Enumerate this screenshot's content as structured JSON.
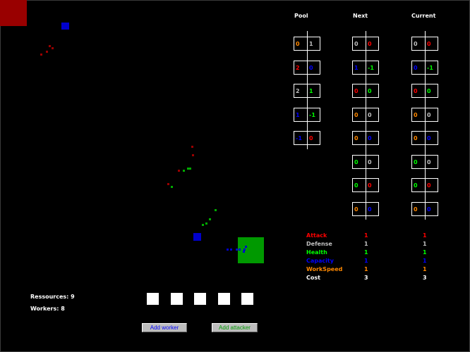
{
  "colors": {
    "background": "#000000",
    "red_base": "#990000",
    "red_unit": "#990000",
    "blue_base": "#0000cc",
    "blue_unit": "#0000cc",
    "green_base": "#009900",
    "green_unit": "#00aa00",
    "attack": "#ff0000",
    "defense": "#c0c0c0",
    "health": "#00ff00",
    "capacity": "#0000ff",
    "workspeed": "#ff8800",
    "cost": "#ffffff"
  },
  "columns": {
    "pool": "Pool",
    "next": "Next",
    "current": "Current"
  },
  "pool": [
    {
      "left": "0",
      "left_color": "workspeed",
      "right": "1",
      "right_color": "defense"
    },
    {
      "left": "2",
      "left_color": "attack",
      "right": "0",
      "right_color": "capacity"
    },
    {
      "left": "2",
      "left_color": "defense",
      "right": "1",
      "right_color": "health"
    },
    {
      "left": "1",
      "left_color": "capacity",
      "right": "-1",
      "right_color": "health"
    },
    {
      "left": "-1",
      "left_color": "capacity",
      "right": "0",
      "right_color": "attack"
    }
  ],
  "next": [
    {
      "left": "0",
      "left_color": "defense",
      "right": "0",
      "right_color": "attack"
    },
    {
      "left": "1",
      "left_color": "capacity",
      "right": "-1",
      "right_color": "health"
    },
    {
      "left": "0",
      "left_color": "attack",
      "right": "0",
      "right_color": "health"
    },
    {
      "left": "0",
      "left_color": "workspeed",
      "right": "0",
      "right_color": "defense"
    },
    {
      "left": "0",
      "left_color": "workspeed",
      "right": "0",
      "right_color": "capacity"
    },
    {
      "left": "0",
      "left_color": "health",
      "right": "0",
      "right_color": "defense"
    },
    {
      "left": "0",
      "left_color": "health",
      "right": "0",
      "right_color": "attack"
    },
    {
      "left": "0",
      "left_color": "workspeed",
      "right": "0",
      "right_color": "capacity"
    }
  ],
  "current": [
    {
      "left": "0",
      "left_color": "defense",
      "right": "0",
      "right_color": "attack"
    },
    {
      "left": "0",
      "left_color": "capacity",
      "right": "-1",
      "right_color": "health"
    },
    {
      "left": "0",
      "left_color": "attack",
      "right": "0",
      "right_color": "health"
    },
    {
      "left": "0",
      "left_color": "workspeed",
      "right": "0",
      "right_color": "defense"
    },
    {
      "left": "0",
      "left_color": "workspeed",
      "right": "0",
      "right_color": "capacity"
    },
    {
      "left": "0",
      "left_color": "health",
      "right": "0",
      "right_color": "defense"
    },
    {
      "left": "0",
      "left_color": "health",
      "right": "0",
      "right_color": "attack"
    },
    {
      "left": "0",
      "left_color": "workspeed",
      "right": "0",
      "right_color": "capacity"
    }
  ],
  "stats": [
    {
      "label": "Attack",
      "color": "attack",
      "next": "1",
      "current": "1"
    },
    {
      "label": "Defense",
      "color": "defense",
      "next": "1",
      "current": "1"
    },
    {
      "label": "Health",
      "color": "health",
      "next": "1",
      "current": "1"
    },
    {
      "label": "Capacity",
      "color": "capacity",
      "next": "1",
      "current": "1"
    },
    {
      "label": "WorkSpeed",
      "color": "workspeed",
      "next": "1",
      "current": "1"
    },
    {
      "label": "Cost",
      "color": "cost",
      "next": "3",
      "current": "3"
    }
  ],
  "info": {
    "resources": "Ressources: 9",
    "workers": "Workers: 8"
  },
  "buttons": {
    "add_worker": "Add worker",
    "add_worker_color": "#0000ff",
    "add_attacker": "Add attacker",
    "add_attacker_color": "#009900"
  },
  "slots_count": 5,
  "map": {
    "red_base": {
      "team": "red"
    },
    "blue_base": {
      "team": "blue"
    },
    "green_base": {
      "team": "green"
    }
  }
}
